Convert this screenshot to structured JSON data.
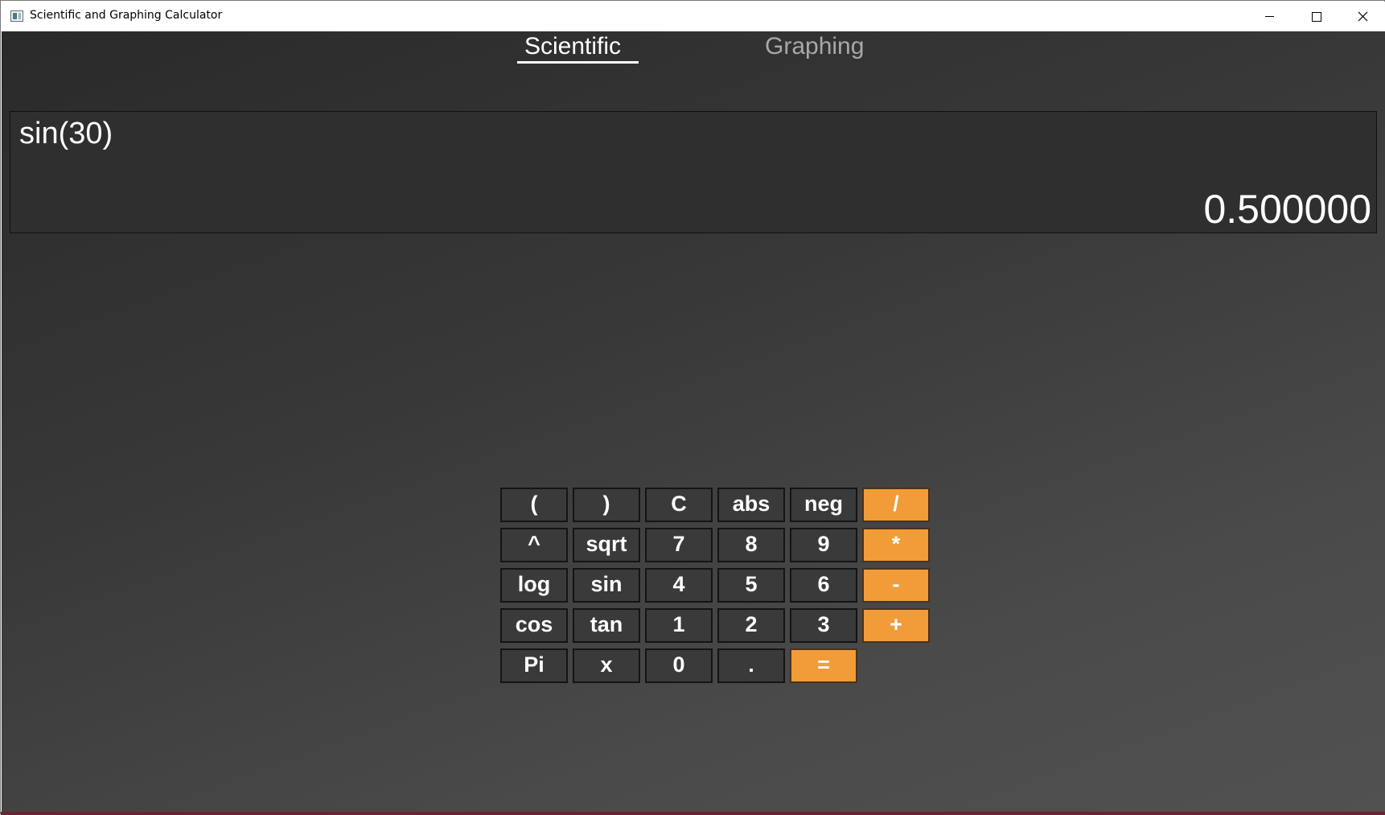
{
  "window": {
    "title": "Scientific and Graphing Calculator",
    "controls": [
      "minimize-icon",
      "maximize-icon",
      "close-icon"
    ]
  },
  "tabs": [
    {
      "label": "Scientific",
      "active": true
    },
    {
      "label": "Graphing",
      "active": false
    }
  ],
  "display": {
    "expression": "sin(30)",
    "result": "0.500000"
  },
  "keypad": {
    "rows": [
      [
        "(",
        ")",
        "C",
        "abs",
        "neg",
        "/"
      ],
      [
        "^",
        "sqrt",
        "7",
        "8",
        "9",
        "*"
      ],
      [
        "log",
        "sin",
        "4",
        "5",
        "6",
        "-"
      ],
      [
        "cos",
        "tan",
        "1",
        "2",
        "3",
        "+"
      ],
      [
        "Pi",
        "x",
        "0",
        ".",
        "="
      ]
    ]
  },
  "colors": {
    "operator_key": "#f19c38",
    "key_background": "#3a3a3a",
    "display_background": "#2f2f2f",
    "active_tab": "#ffffff",
    "inactive_tab": "#a8a8a8"
  }
}
